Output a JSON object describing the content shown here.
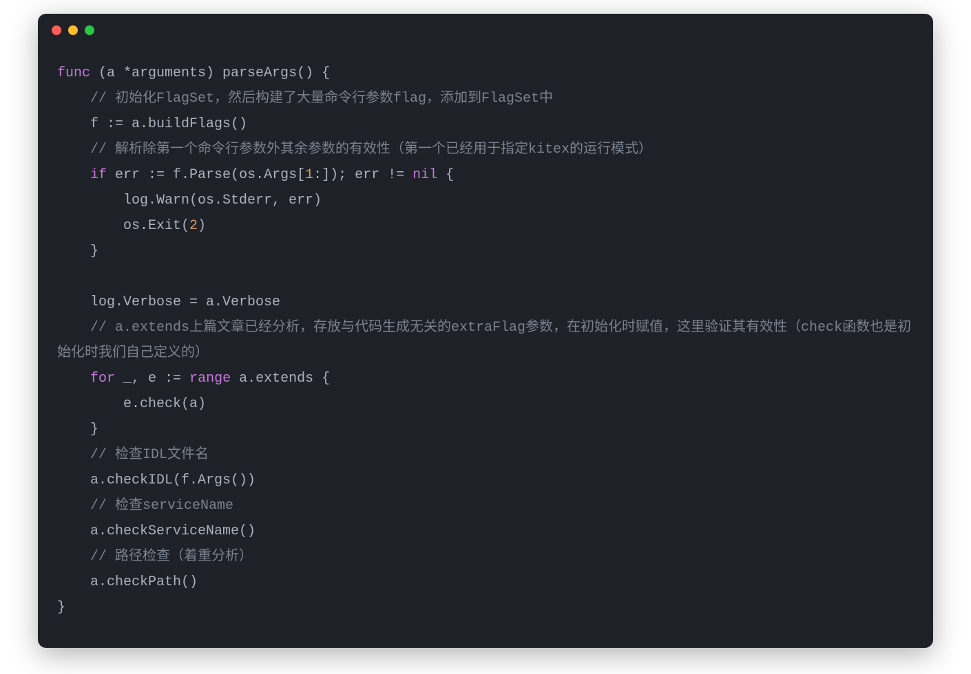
{
  "window": {
    "traffic_lights": [
      "close",
      "minimize",
      "maximize"
    ]
  },
  "code": {
    "tokens": [
      {
        "t": "kw",
        "v": "func"
      },
      {
        "t": "ident",
        "v": " (a *arguments) parseArgs() {\n"
      },
      {
        "t": "comment",
        "v": "    // 初始化FlagSet，然后构建了大量命令行参数flag，添加到FlagSet中\n"
      },
      {
        "t": "ident",
        "v": "    f := a.buildFlags()\n"
      },
      {
        "t": "comment",
        "v": "    // 解析除第一个命令行参数外其余参数的有效性（第一个已经用于指定kitex的运行模式）\n"
      },
      {
        "t": "ident",
        "v": "    "
      },
      {
        "t": "kw",
        "v": "if"
      },
      {
        "t": "ident",
        "v": " err := f.Parse(os.Args["
      },
      {
        "t": "num",
        "v": "1"
      },
      {
        "t": "ident",
        "v": ":]); err != "
      },
      {
        "t": "kw",
        "v": "nil"
      },
      {
        "t": "ident",
        "v": " {\n"
      },
      {
        "t": "ident",
        "v": "        log.Warn(os.Stderr, err)\n"
      },
      {
        "t": "ident",
        "v": "        os.Exit("
      },
      {
        "t": "num",
        "v": "2"
      },
      {
        "t": "ident",
        "v": ")\n"
      },
      {
        "t": "ident",
        "v": "    }\n"
      },
      {
        "t": "ident",
        "v": "\n"
      },
      {
        "t": "ident",
        "v": "    log.Verbose = a.Verbose\n"
      },
      {
        "t": "comment",
        "v": "    // a.extends上篇文章已经分析，存放与代码生成无关的extraFlag参数，在初始化时赋值，这里验证其有效性（check函数也是初始化时我们自己定义的）\n"
      },
      {
        "t": "ident",
        "v": "    "
      },
      {
        "t": "kw",
        "v": "for"
      },
      {
        "t": "ident",
        "v": " _, e := "
      },
      {
        "t": "kw",
        "v": "range"
      },
      {
        "t": "ident",
        "v": " a.extends {\n"
      },
      {
        "t": "ident",
        "v": "        e.check(a)\n"
      },
      {
        "t": "ident",
        "v": "    }\n"
      },
      {
        "t": "comment",
        "v": "    // 检查IDL文件名\n"
      },
      {
        "t": "ident",
        "v": "    a.checkIDL(f.Args())\n"
      },
      {
        "t": "comment",
        "v": "    // 检查serviceName\n"
      },
      {
        "t": "ident",
        "v": "    a.checkServiceName()\n"
      },
      {
        "t": "comment",
        "v": "    // 路径检查（着重分析）\n"
      },
      {
        "t": "ident",
        "v": "    a.checkPath()\n"
      },
      {
        "t": "ident",
        "v": "}"
      }
    ]
  }
}
